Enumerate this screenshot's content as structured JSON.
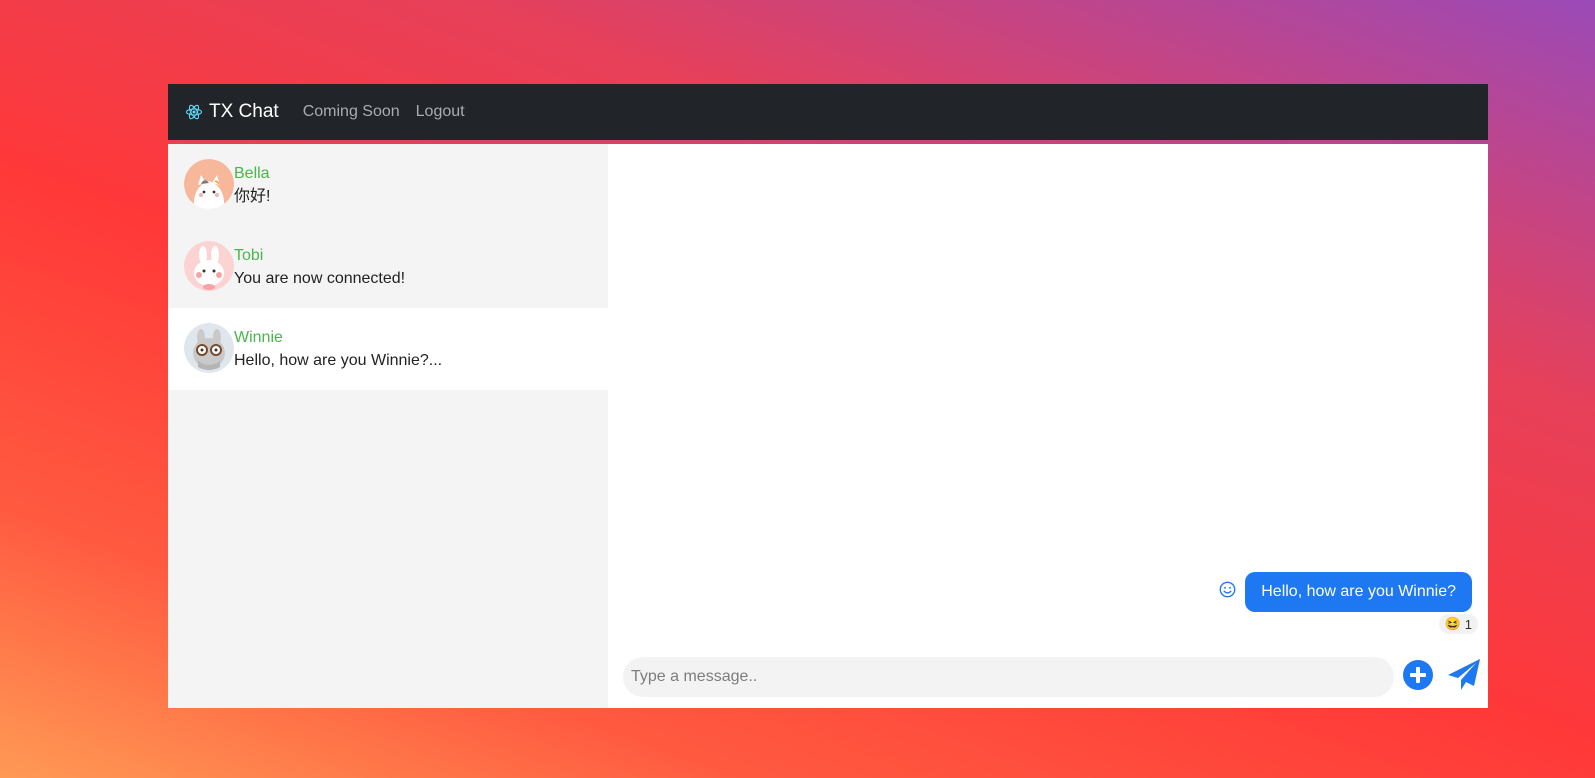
{
  "navbar": {
    "brand_icon": "react-atom-icon",
    "brand": "TX Chat",
    "links": [
      "Coming Soon",
      "Logout"
    ]
  },
  "contacts": [
    {
      "name": "Bella",
      "last_message": "你好!",
      "avatar": "cat-avatar",
      "active": false
    },
    {
      "name": "Tobi",
      "last_message": "You are now connected!",
      "avatar": "bunny-avatar",
      "active": false
    },
    {
      "name": "Winnie",
      "last_message": "Hello, how are you Winnie?...",
      "avatar": "glasses-bunny-avatar",
      "active": true
    }
  ],
  "chat": {
    "messages": [
      {
        "text": "Hello, how are you Winnie?",
        "reaction": "😆",
        "reaction_count": "1"
      }
    ],
    "input_placeholder": "Type a message..",
    "icons": {
      "emoji": "smiley-icon",
      "attach": "plus-circle-icon",
      "send": "paper-plane-icon"
    }
  },
  "colors": {
    "accent": "#1e78f2",
    "contact_name": "#4ab54a",
    "navbar_bg": "#212529"
  }
}
